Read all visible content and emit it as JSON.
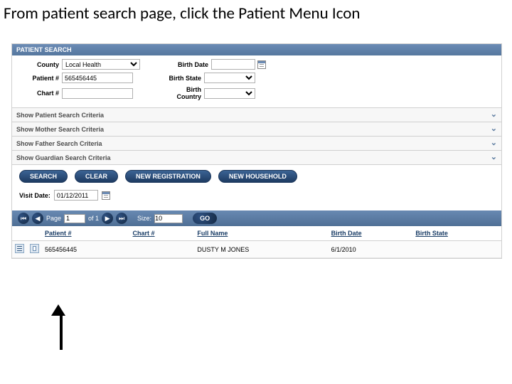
{
  "caption": "From patient search page, click the Patient Menu Icon",
  "title_bar": "PATIENT SEARCH",
  "form": {
    "county_label": "County",
    "county_value": "Local Health",
    "birth_date_label": "Birth Date",
    "birth_date_value": "",
    "patient_no_label": "Patient #",
    "patient_no_value": "565456445",
    "birth_state_label": "Birth State",
    "birth_state_value": "",
    "chart_no_label": "Chart #",
    "chart_no_value": "",
    "birth_country_label": "Birth Country",
    "birth_country_value": ""
  },
  "accordions": [
    "Show Patient Search Criteria",
    "Show Mother Search Criteria",
    "Show Father Search Criteria",
    "Show Guardian Search Criteria"
  ],
  "buttons": {
    "search": "SEARCH",
    "clear": "CLEAR",
    "new_reg": "NEW REGISTRATION",
    "new_hh": "NEW HOUSEHOLD"
  },
  "visit": {
    "label": "Visit Date:",
    "value": "01/12/2011"
  },
  "pager": {
    "page_label": "Page",
    "page_value": "1",
    "of_label": "of 1",
    "size_label": "Size:",
    "size_value": "10",
    "go": "GO"
  },
  "columns": {
    "patient_no": "Patient #",
    "chart_no": "Chart #",
    "full_name": "Full Name",
    "birth_date": "Birth Date",
    "birth_state": "Birth State"
  },
  "rows": [
    {
      "patient_no": "565456445",
      "chart_no": "",
      "full_name": "DUSTY M JONES",
      "birth_date": "6/1/2010",
      "birth_state": ""
    }
  ]
}
